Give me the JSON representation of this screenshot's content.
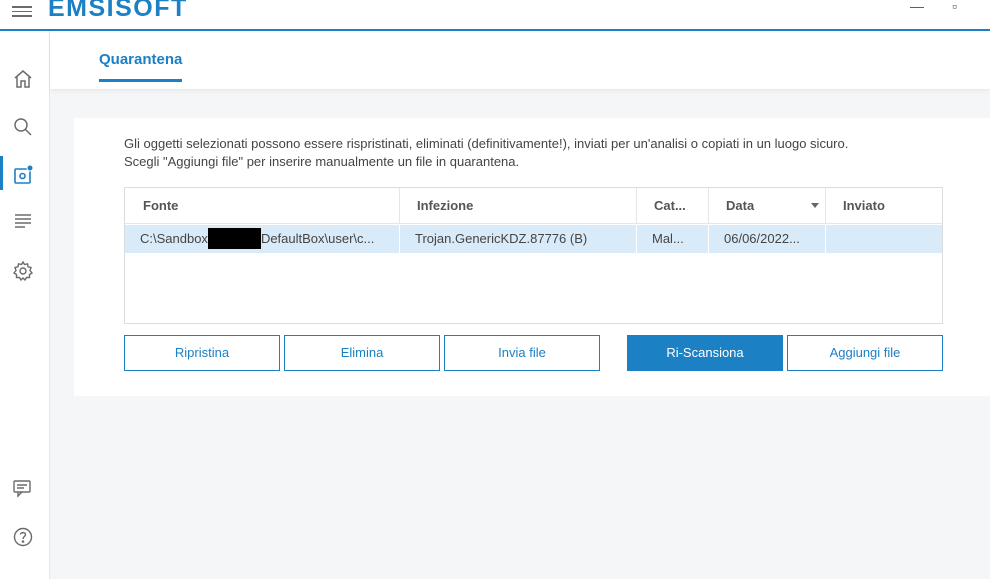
{
  "app": {
    "logo": "EMSISOFT"
  },
  "window": {
    "minimize": "—",
    "maximize": "▫"
  },
  "sidebar": {
    "items": [
      {
        "name": "home",
        "icon": "home-icon"
      },
      {
        "name": "scan",
        "icon": "search-icon"
      },
      {
        "name": "quarantine",
        "icon": "quarantine-icon"
      },
      {
        "name": "logs",
        "icon": "logs-icon"
      },
      {
        "name": "settings",
        "icon": "gear-icon"
      },
      {
        "name": "feedback",
        "icon": "chat-icon"
      },
      {
        "name": "help",
        "icon": "help-icon"
      }
    ]
  },
  "tabs": [
    {
      "label": "Quarantena"
    }
  ],
  "description": {
    "line1": "Gli oggetti selezionati possono essere rispristinati, eliminati (definitivamente!), inviati per un'analisi o copiati in un luogo sicuro.",
    "line2": "Scegli \"Aggiungi file\" per inserire manualmente un file in quarantena."
  },
  "table": {
    "columns": [
      "Fonte",
      "Infezione",
      "Cat...",
      "Data",
      "Inviato"
    ],
    "rows": [
      {
        "fonte_prefix": "C:\\Sandbox",
        "fonte_suffix": "DefaultBox\\user\\c...",
        "infezione": "Trojan.GenericKDZ.87776 (B)",
        "cat": "Mal...",
        "data": "06/06/2022...",
        "inviato": ""
      }
    ]
  },
  "buttons": {
    "restore": "Ripristina",
    "delete": "Elimina",
    "send": "Invia file",
    "rescan": "Ri-Scansiona",
    "add": "Aggiungi file"
  },
  "colors": {
    "accent": "#1b80c4",
    "selected_row": "#d9ebf9",
    "badge": "#1b80c4"
  }
}
